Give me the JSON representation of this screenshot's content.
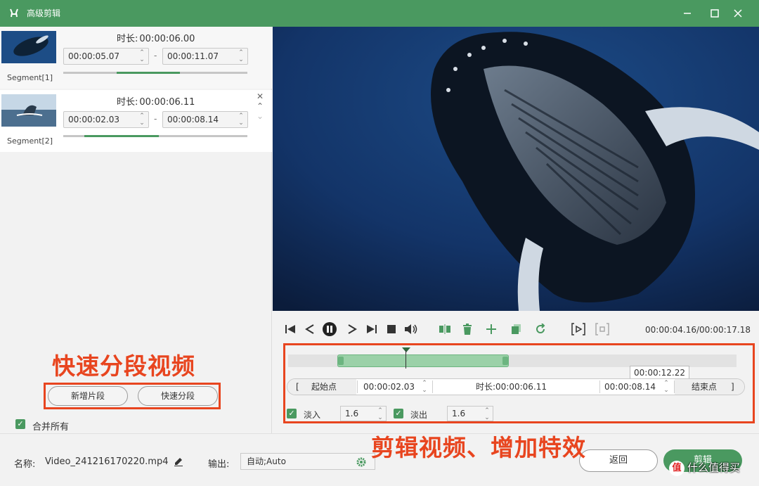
{
  "window": {
    "title": "高级剪辑"
  },
  "segments": [
    {
      "label": "Segment[1]",
      "duration_label": "时长:",
      "duration": "00:00:06.00",
      "start": "00:00:05.07",
      "end": "00:00:11.07",
      "sep": "-"
    },
    {
      "label": "Segment[2]",
      "duration_label": "时长:",
      "duration": "00:00:06.11",
      "start": "00:00:02.03",
      "end": "00:00:08.14",
      "sep": "-"
    }
  ],
  "left": {
    "annotation": "快速分段视频",
    "add_segment": "新增片段",
    "quick_split": "快速分段",
    "merge_all": "合并所有"
  },
  "player": {
    "time": "00:00:04.16/00:00:17.18",
    "tooltip": "00:00:12.22"
  },
  "trim": {
    "open_bracket": "[",
    "start_btn": "起始点",
    "start_time": "00:00:02.03",
    "duration_label": "时长:",
    "duration": "00:00:06.11",
    "end_time": "00:00:08.14",
    "end_btn": "结束点",
    "close_bracket": "]"
  },
  "fade": {
    "fade_in_label": "淡入",
    "fade_in_value": "1.6",
    "fade_out_label": "淡出",
    "fade_out_value": "1.6"
  },
  "right_annotation": "剪辑视频、增加特效",
  "bottom": {
    "name_label": "名称:",
    "name_value": "Video_241216170220.mp4",
    "output_label": "输出:",
    "output_value": "自动;Auto",
    "back": "返回",
    "edit": "剪辑"
  },
  "watermark": {
    "icon": "值",
    "text": "什么值得买"
  },
  "colors": {
    "accent": "#4a9960",
    "annotation": "#e8451f"
  }
}
